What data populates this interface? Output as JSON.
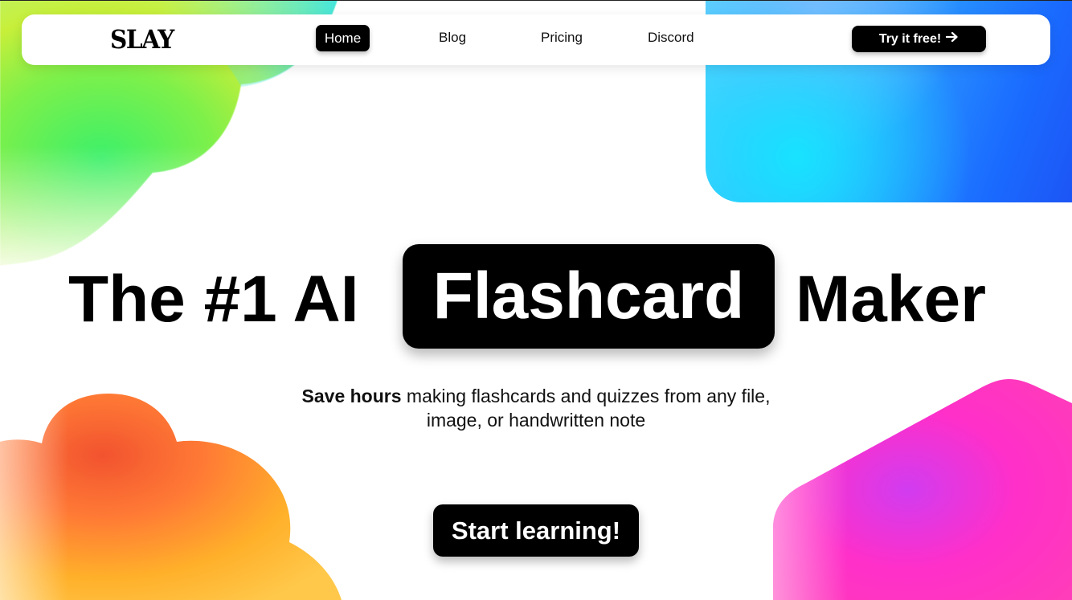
{
  "brand": {
    "logo": "SLAY"
  },
  "nav": {
    "items": [
      {
        "label": "Home",
        "active": true
      },
      {
        "label": "Blog",
        "active": false
      },
      {
        "label": "Pricing",
        "active": false
      },
      {
        "label": "Discord",
        "active": false
      }
    ],
    "cta_label": "Try it free!",
    "cta_icon": "arrow-right-icon"
  },
  "hero": {
    "title_before": "The #1 AI",
    "title_highlight": "Flashcard",
    "title_after": "Maker",
    "subtitle_bold": "Save hours",
    "subtitle_rest": "making flashcards and quizzes from any file,",
    "subtitle_line2": "image, or handwritten note",
    "cta_label": "Start learning!"
  },
  "colors": {
    "primary": "#000000",
    "background": "#ffffff",
    "blob_green": "#3cf06a",
    "blob_blue": "#1a9bff",
    "blob_orange": "#ff8a2a",
    "blob_pink": "#ff2fc9"
  }
}
